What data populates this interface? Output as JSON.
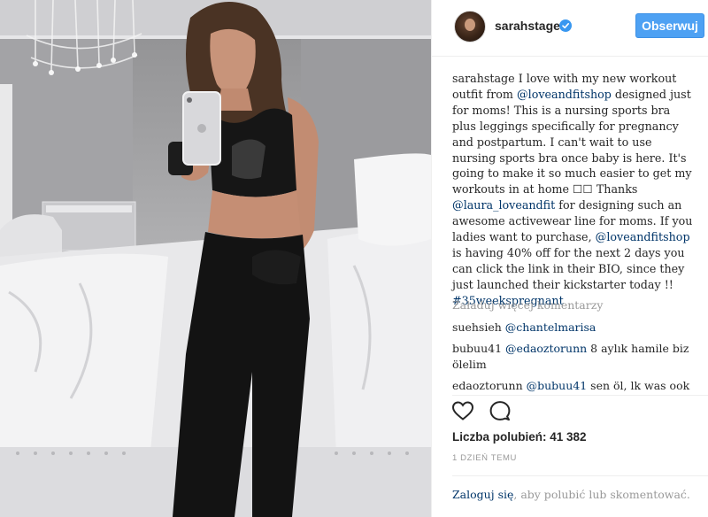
{
  "post": {
    "username": "sarahstage",
    "follow_label": "Obserwuj",
    "caption": {
      "author": "sarahstage",
      "parts": [
        {
          "text": " I love with my new workout outfit from ",
          "type": "text"
        },
        {
          "text": "@loveandfitshop",
          "type": "link"
        },
        {
          "text": " designed just for moms! This is a nursing sports bra plus leggings specifically for pregnancy and postpartum. I can't wait to use nursing sports bra once baby is here. It's going to make it so much easier to get my workouts in at home ☐☐ Thanks ",
          "type": "text"
        },
        {
          "text": "@laura_loveandfit",
          "type": "link"
        },
        {
          "text": " for designing such an awesome activewear line for moms. If you ladies want to purchase, ",
          "type": "text"
        },
        {
          "text": "@loveandfitshop",
          "type": "link"
        },
        {
          "text": " is having 40% off for the next 2 days you can click the link in their BIO, since they just launched their kickstarter today !! ",
          "type": "text"
        },
        {
          "text": "#35weekspregnant",
          "type": "link"
        }
      ]
    },
    "load_more_label": "Załaduj więcej komentarzy",
    "comments": [
      {
        "user": "suehsieh",
        "mention": "@chantelmarisa",
        "text": ""
      },
      {
        "user": "bubuu41",
        "mention": "@edaoztorunn",
        "text": " 8 aylık hamile biz ölelim"
      },
      {
        "user": "edaoztorunn",
        "mention": "@bubuu41",
        "text": " sen öl, lk was ook"
      }
    ],
    "likes_label": "Liczba polubień: 41 382",
    "timestamp": "1 DZIEŃ TEMU",
    "login_link": "Zaloguj się",
    "login_rest": ", aby polubić lub skomentować."
  },
  "colors": {
    "accent": "#4ea1f3",
    "link": "#003569",
    "muted": "#999999",
    "verified": "#3897f0"
  },
  "icons": [
    "verified-badge-icon",
    "heart-icon",
    "comment-icon"
  ]
}
